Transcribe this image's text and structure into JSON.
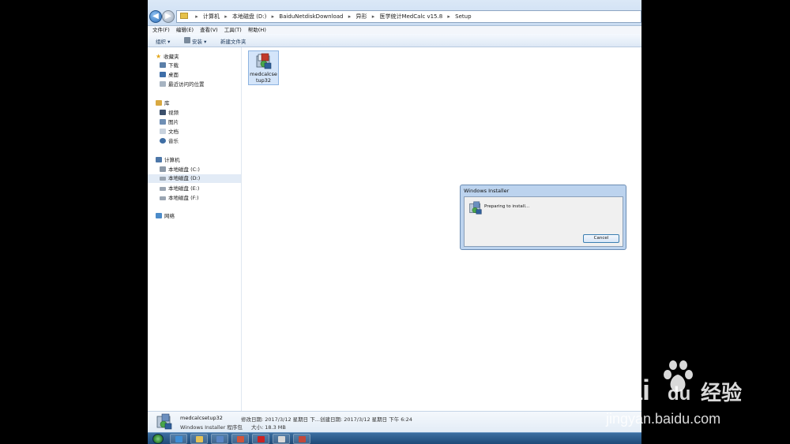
{
  "address_bar": {
    "segments": [
      "计算机",
      "本地磁盘 (D:)",
      "BaiduNetdiskDownload",
      "异形",
      "医学统计MedCalc v15.8",
      "Setup"
    ],
    "separator": "▸"
  },
  "menu": [
    "文件(F)",
    "编辑(E)",
    "查看(V)",
    "工具(T)",
    "帮助(H)"
  ],
  "toolbar": {
    "organize": "组织 ▾",
    "install": "安装 ▾",
    "new_folder": "新建文件夹"
  },
  "nav": {
    "favorites_label": "收藏夹",
    "favorites": [
      "下载",
      "桌面",
      "最近访问的位置"
    ],
    "libraries_label": "库",
    "libraries": [
      "视频",
      "图片",
      "文档",
      "音乐"
    ],
    "computer_label": "计算机",
    "drives": [
      "本地磁盘 (C:)",
      "本地磁盘 (D:)",
      "本地磁盘 (E:)",
      "本地磁盘 (F:)"
    ],
    "network_label": "网络"
  },
  "file": {
    "name_line1": "medcalcse",
    "name_line2": "tup32"
  },
  "dialog": {
    "title": "Windows Installer",
    "message": "Preparing to install...",
    "cancel": "Cancel"
  },
  "details": {
    "name": "medcalcsetup32",
    "type": "Windows Installer 程序包",
    "modified": "修改日期: 2017/3/12 星期日 下...",
    "created": "创建日期: 2017/3/12 星期日 下午 6:24",
    "size": "大小: 18.3 MB"
  },
  "watermark": {
    "brand": "Bai",
    "brand2": "du",
    "product": "经验",
    "url": "jingyan.baidu.com"
  }
}
